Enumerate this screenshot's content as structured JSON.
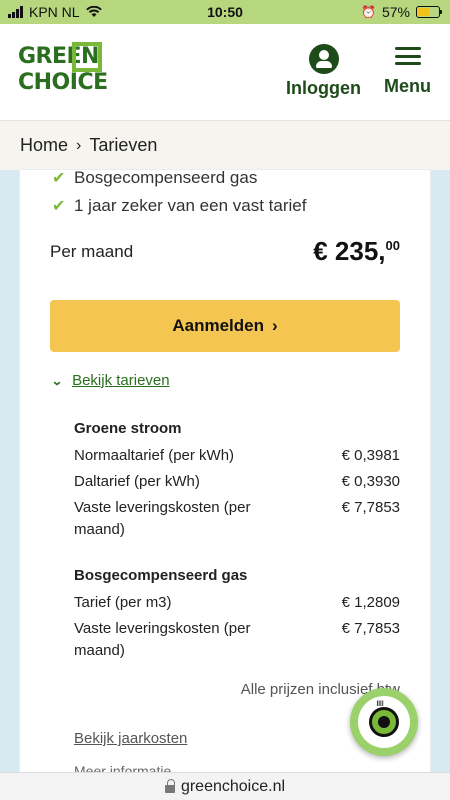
{
  "status_bar": {
    "carrier": "KPN NL",
    "time": "10:50",
    "battery": "57%"
  },
  "header": {
    "logo_line1": "GREEN",
    "logo_line2": "CHOICE",
    "login_label": "Inloggen",
    "menu_label": "Menu"
  },
  "breadcrumb": {
    "home": "Home",
    "separator": "›",
    "current": "Tarieven"
  },
  "features": [
    "Bosgecompenseerd gas",
    "1 jaar zeker van een vast tarief"
  ],
  "price": {
    "label": "Per maand",
    "main": "€ 235,",
    "decimals": "00"
  },
  "cta": {
    "label": "Aanmelden",
    "arrow": "›"
  },
  "tariffs_link": "Bekijk tarieven",
  "stroom": {
    "title": "Groene stroom",
    "rows": [
      {
        "name": "Normaaltarief (per kWh)",
        "value": "€ 0,3981"
      },
      {
        "name": "Daltarief (per kWh)",
        "value": "€ 0,3930"
      },
      {
        "name": "Vaste leveringskosten (per maand)",
        "value": "€ 7,7853"
      }
    ]
  },
  "gas": {
    "title": "Bosgecompenseerd gas",
    "rows": [
      {
        "name": "Tarief (per m3)",
        "value": "€ 1,2809"
      },
      {
        "name": "Vaste leveringskosten (per maand)",
        "value": "€ 7,7853"
      }
    ]
  },
  "note": "Alle prijzen inclusief btw",
  "jaarkosten_link": "Bekijk jaarkosten",
  "meer_info": "Meer informatie",
  "url": "greenchoice.nl",
  "colors": {
    "brand_green": "#2c6e1f",
    "accent_green": "#7ab83a",
    "cta_yellow": "#f5c552",
    "status_bar": "#b6d77e"
  }
}
